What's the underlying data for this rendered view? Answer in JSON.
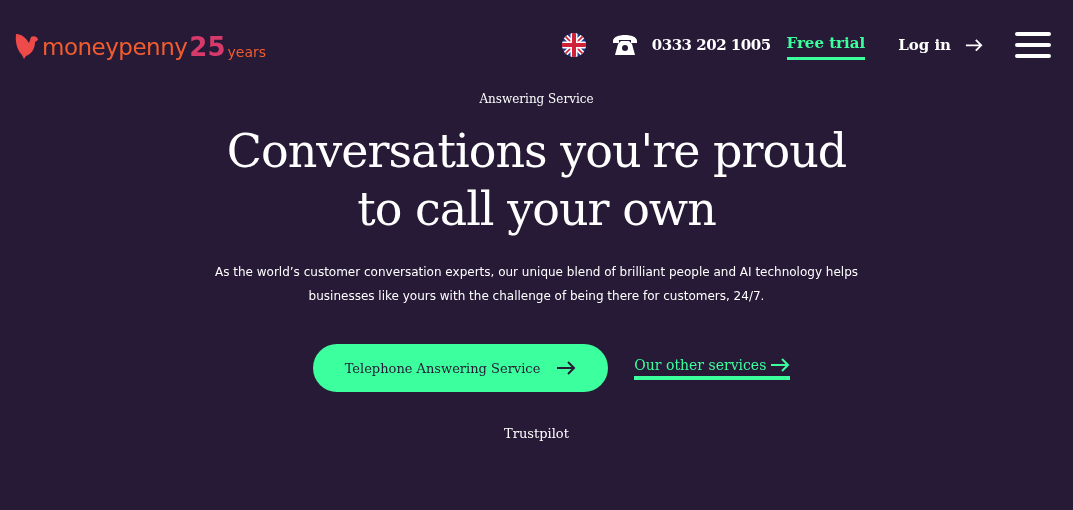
{
  "header": {
    "logo": {
      "name": "moneypenny",
      "number": "25",
      "suffix": "years"
    },
    "phone": "0333 202 1005",
    "free_trial": "Free trial",
    "login": "Log in"
  },
  "hero": {
    "eyebrow": "Answering Service",
    "title": "Conversations you're proud to call your own",
    "description": "As the world’s customer conversation experts, our unique blend of brilliant people and AI technology helps businesses like yours with the challenge of being there for customers, 24/7.",
    "primary_button": "Telephone Answering Service",
    "secondary_link": "Our other services",
    "trustpilot": "Trustpilot"
  }
}
